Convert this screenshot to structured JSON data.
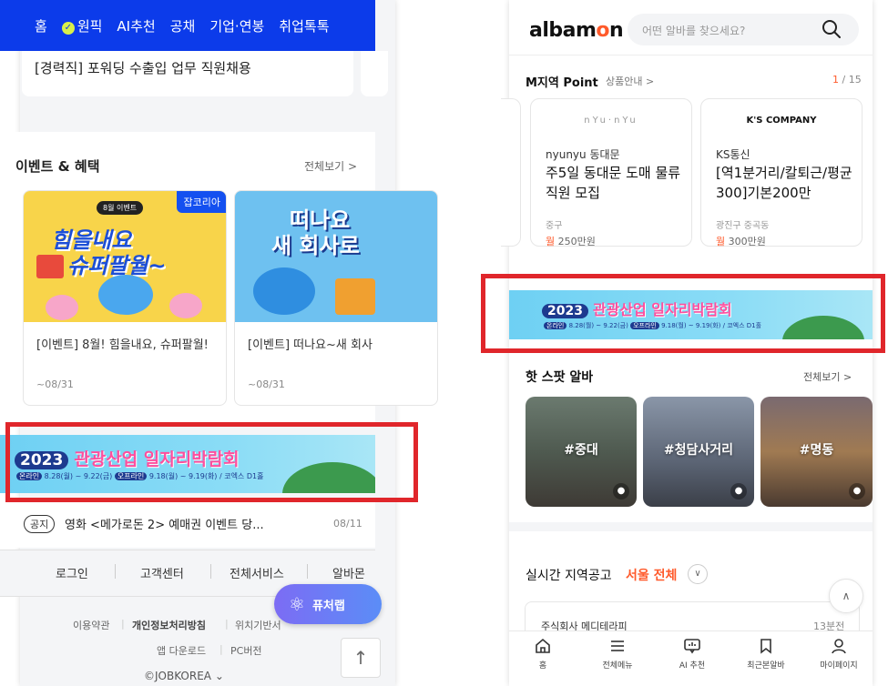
{
  "left": {
    "nav": {
      "items": [
        "홈",
        "원픽",
        "AI추천",
        "공채",
        "기업·연봉",
        "취업톡톡"
      ]
    },
    "job_card_text": "[경력직] 포워딩 수출입 업무 직원채용",
    "events": {
      "title": "이벤트 & 혜택",
      "more": "전체보기 >",
      "cards": [
        {
          "badge": "잡코리아",
          "tag": "8월 이벤트",
          "promo_line1": "힘을내요",
          "promo_line2": "슈퍼팔월~",
          "text": "[이벤트] 8월! 힘을내요, 슈퍼팔월!",
          "date": "~08/31"
        },
        {
          "promo_line1": "떠나요",
          "promo_line2": "새 회사로",
          "text": "[이벤트] 떠나요~새 회사",
          "date": "~08/31"
        }
      ]
    },
    "banner": {
      "year": "2023",
      "title": "관광산업 일자리박람회",
      "pill1": "온라인",
      "date1": "8.28(월) ~ 9.22(금)",
      "pill2": "오프라인",
      "date2": "9.18(월) ~ 9.19(화) / 코엑스 D1홀"
    },
    "notice": {
      "tag": "공지",
      "text": "영화 <메가로돈 2> 예매권 이벤트 당...",
      "date": "08/11"
    },
    "footer": {
      "links": [
        "로그인",
        "고객센터",
        "전체서비스",
        "알바몬"
      ],
      "terms": "이용약관",
      "privacy": "개인정보처리방침",
      "location": "위치기반서",
      "app": "앱 다운로드",
      "pc": "PC버전",
      "copyright": "©JOBKOREA ⌄"
    },
    "futurelab": "퓨처랩"
  },
  "right": {
    "logo_pre": "albam",
    "logo_o": "o",
    "logo_post": "n",
    "search_placeholder": "어떤 알바를 찾으세요?",
    "point": {
      "title": "M지역 Point",
      "sub": "상품안내 >",
      "count_current": "1",
      "count_total": " / 15",
      "cards": [
        {
          "brand": "nYu·nYu",
          "company": "nyunyu 동대문",
          "job": "주5일 동대문 도매 물류 직원 모집",
          "loc": "중구",
          "pay_unit": "월",
          "pay": " 250만원"
        },
        {
          "brand": "K'S COMPANY",
          "company": "KS통신",
          "job": "[역1분거리/칼퇴근/평균300]기본200만",
          "loc": "광진구 중곡동",
          "pay_unit": "월",
          "pay": " 300만원"
        }
      ]
    },
    "hotspot": {
      "title": "핫 스팟 알바",
      "more": "전체보기 >",
      "items": [
        "#중대",
        "#청담사거리",
        "#명동"
      ]
    },
    "realtime": {
      "title": "실시간 지역공고",
      "region": "서울 전체",
      "company": "주식회사 메디테라피",
      "time": "13분전"
    },
    "bottom_nav": [
      "홈",
      "전체메뉴",
      "AI 추천",
      "최근본알바",
      "마이페이지"
    ]
  },
  "colors": {
    "jobkorea_blue": "#0c3bea",
    "albamon_orange": "#ff5a2b",
    "highlight_red": "#e0262b"
  }
}
